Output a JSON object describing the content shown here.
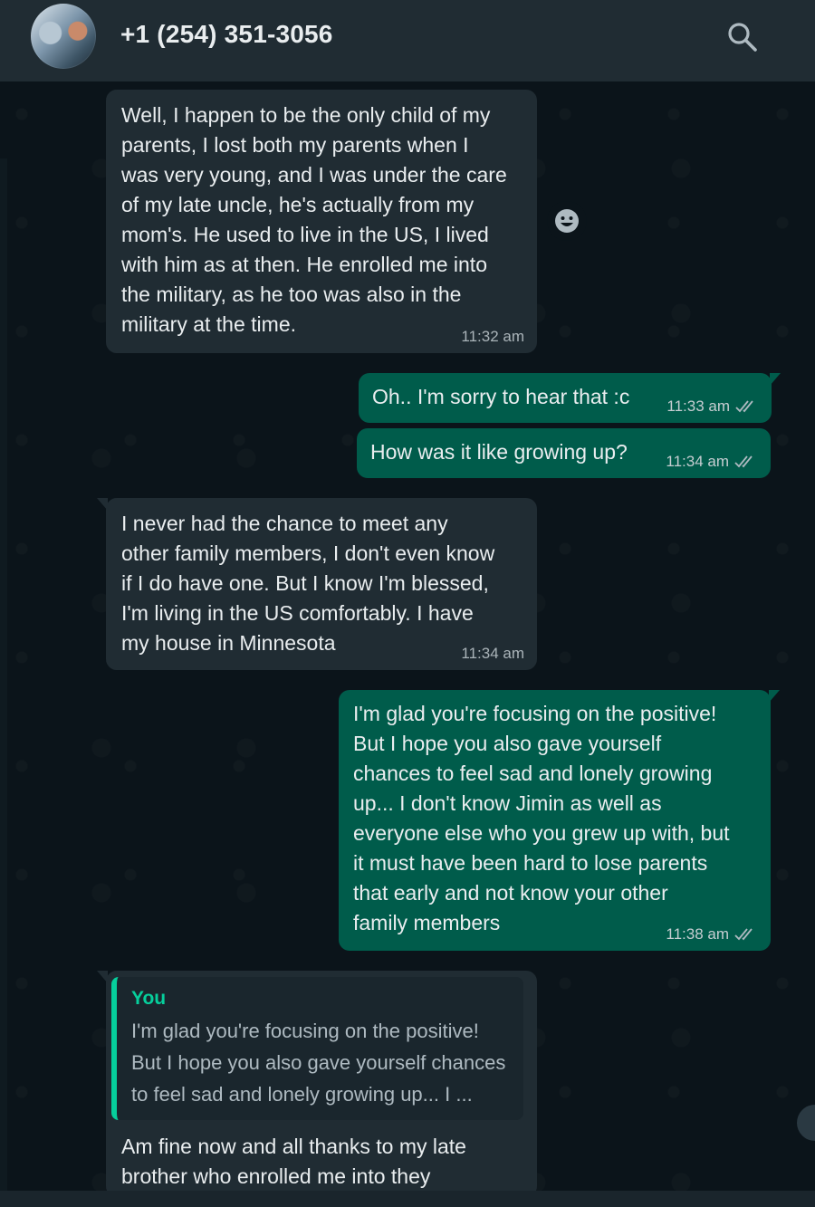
{
  "header": {
    "contact_name": "+1 (254) 351-3056",
    "avatar_icon": "contact-avatar",
    "search_icon": "search-icon"
  },
  "messages": [
    {
      "direction": "incoming",
      "text": "Well, I happen to be the only child of my\nparents, I lost both my parents when I\nwas very young, and I was under the care\nof my late uncle, he's actually from my\nmom's. He used to live in the US, I lived\nwith him as at then. He enrolled me into\nthe military, as he too was also in the\nmilitary at the time.",
      "time": "11:32 am"
    },
    {
      "direction": "outgoing",
      "text": "Oh.. I'm sorry to hear that :c",
      "time": "11:33 am",
      "status": "read"
    },
    {
      "direction": "outgoing",
      "text": "How was it like growing up?",
      "time": "11:34 am",
      "status": "read"
    },
    {
      "direction": "incoming",
      "text": "I never had the chance to meet any\nother family members, I don't even know\nif I do have one. But I know I'm blessed,\nI'm living in the US comfortably. I have\nmy house in Minnesota",
      "time": "11:34 am"
    },
    {
      "direction": "outgoing",
      "text": "I'm glad you're focusing on the positive!\nBut I hope you also gave yourself\nchances to feel sad and lonely growing\nup... I don't know Jimin as well as\neveryone else who you grew up with, but\nit must have been hard to lose parents\nthat early and not know your other\nfamily members",
      "time": "11:38 am",
      "status": "read"
    },
    {
      "direction": "incoming",
      "quote": {
        "author": "You",
        "text": "I'm glad you're focusing on the positive!\nBut I hope you also gave yourself chances\nto feel sad and lonely growing up... I ..."
      },
      "text": "Am fine now and all thanks to my late\nbrother who enrolled me into they"
    }
  ],
  "colors": {
    "background": "#0b141a",
    "header": "#202c33",
    "incoming_bubble": "#202c33",
    "outgoing_bubble": "#005c4b",
    "quote_accent": "#06cf9c"
  }
}
